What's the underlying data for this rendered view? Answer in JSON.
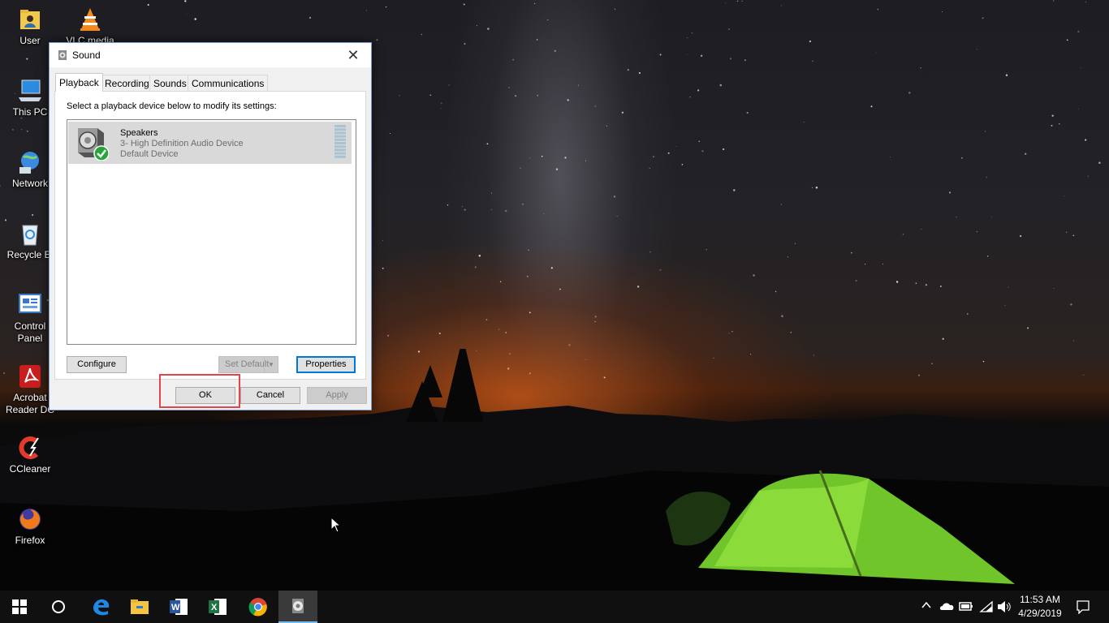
{
  "desktop": {
    "icons": [
      {
        "label": "User",
        "icon": "user-folder-icon"
      },
      {
        "label": "VLC media",
        "icon": "vlc-icon"
      },
      {
        "label": "This PC",
        "icon": "computer-icon"
      },
      {
        "label": "Network",
        "icon": "network-icon"
      },
      {
        "label": "Recycle Bi",
        "icon": "recycle-bin-icon"
      },
      {
        "label": "Control\nPanel",
        "icon": "control-panel-icon"
      },
      {
        "label": "Acrobat\nReader DC",
        "icon": "acrobat-icon"
      },
      {
        "label": "CCleaner",
        "icon": "ccleaner-icon"
      },
      {
        "label": "Firefox",
        "icon": "firefox-icon"
      }
    ]
  },
  "dialog": {
    "title": "Sound",
    "close_symbol": "✕",
    "tabs": [
      {
        "label": "Playback",
        "active": true
      },
      {
        "label": "Recording",
        "active": false
      },
      {
        "label": "Sounds",
        "active": false
      },
      {
        "label": "Communications",
        "active": false
      }
    ],
    "instruction": "Select a playback device below to modify its settings:",
    "device": {
      "name": "Speakers",
      "description": "3- High Definition Audio Device",
      "status": "Default Device"
    },
    "buttons": {
      "configure": "Configure",
      "set_default": "Set Default",
      "properties": "Properties",
      "ok": "OK",
      "cancel": "Cancel",
      "apply": "Apply"
    }
  },
  "taskbar": {
    "apps": [
      "start-icon",
      "cortana-icon",
      "edge-icon",
      "file-explorer-icon",
      "word-icon",
      "excel-icon",
      "chrome-icon",
      "sound-icon"
    ],
    "tray_icons": [
      "chevron-up-icon",
      "onedrive-icon",
      "battery-icon",
      "wifi-icon",
      "volume-icon"
    ],
    "time": "11:53 AM",
    "date": "4/29/2019",
    "notification_icon": "action-center-icon"
  },
  "colors": {
    "accent": "#0078d7",
    "highlight_box": "#e0464b",
    "taskbar": "#101010"
  }
}
